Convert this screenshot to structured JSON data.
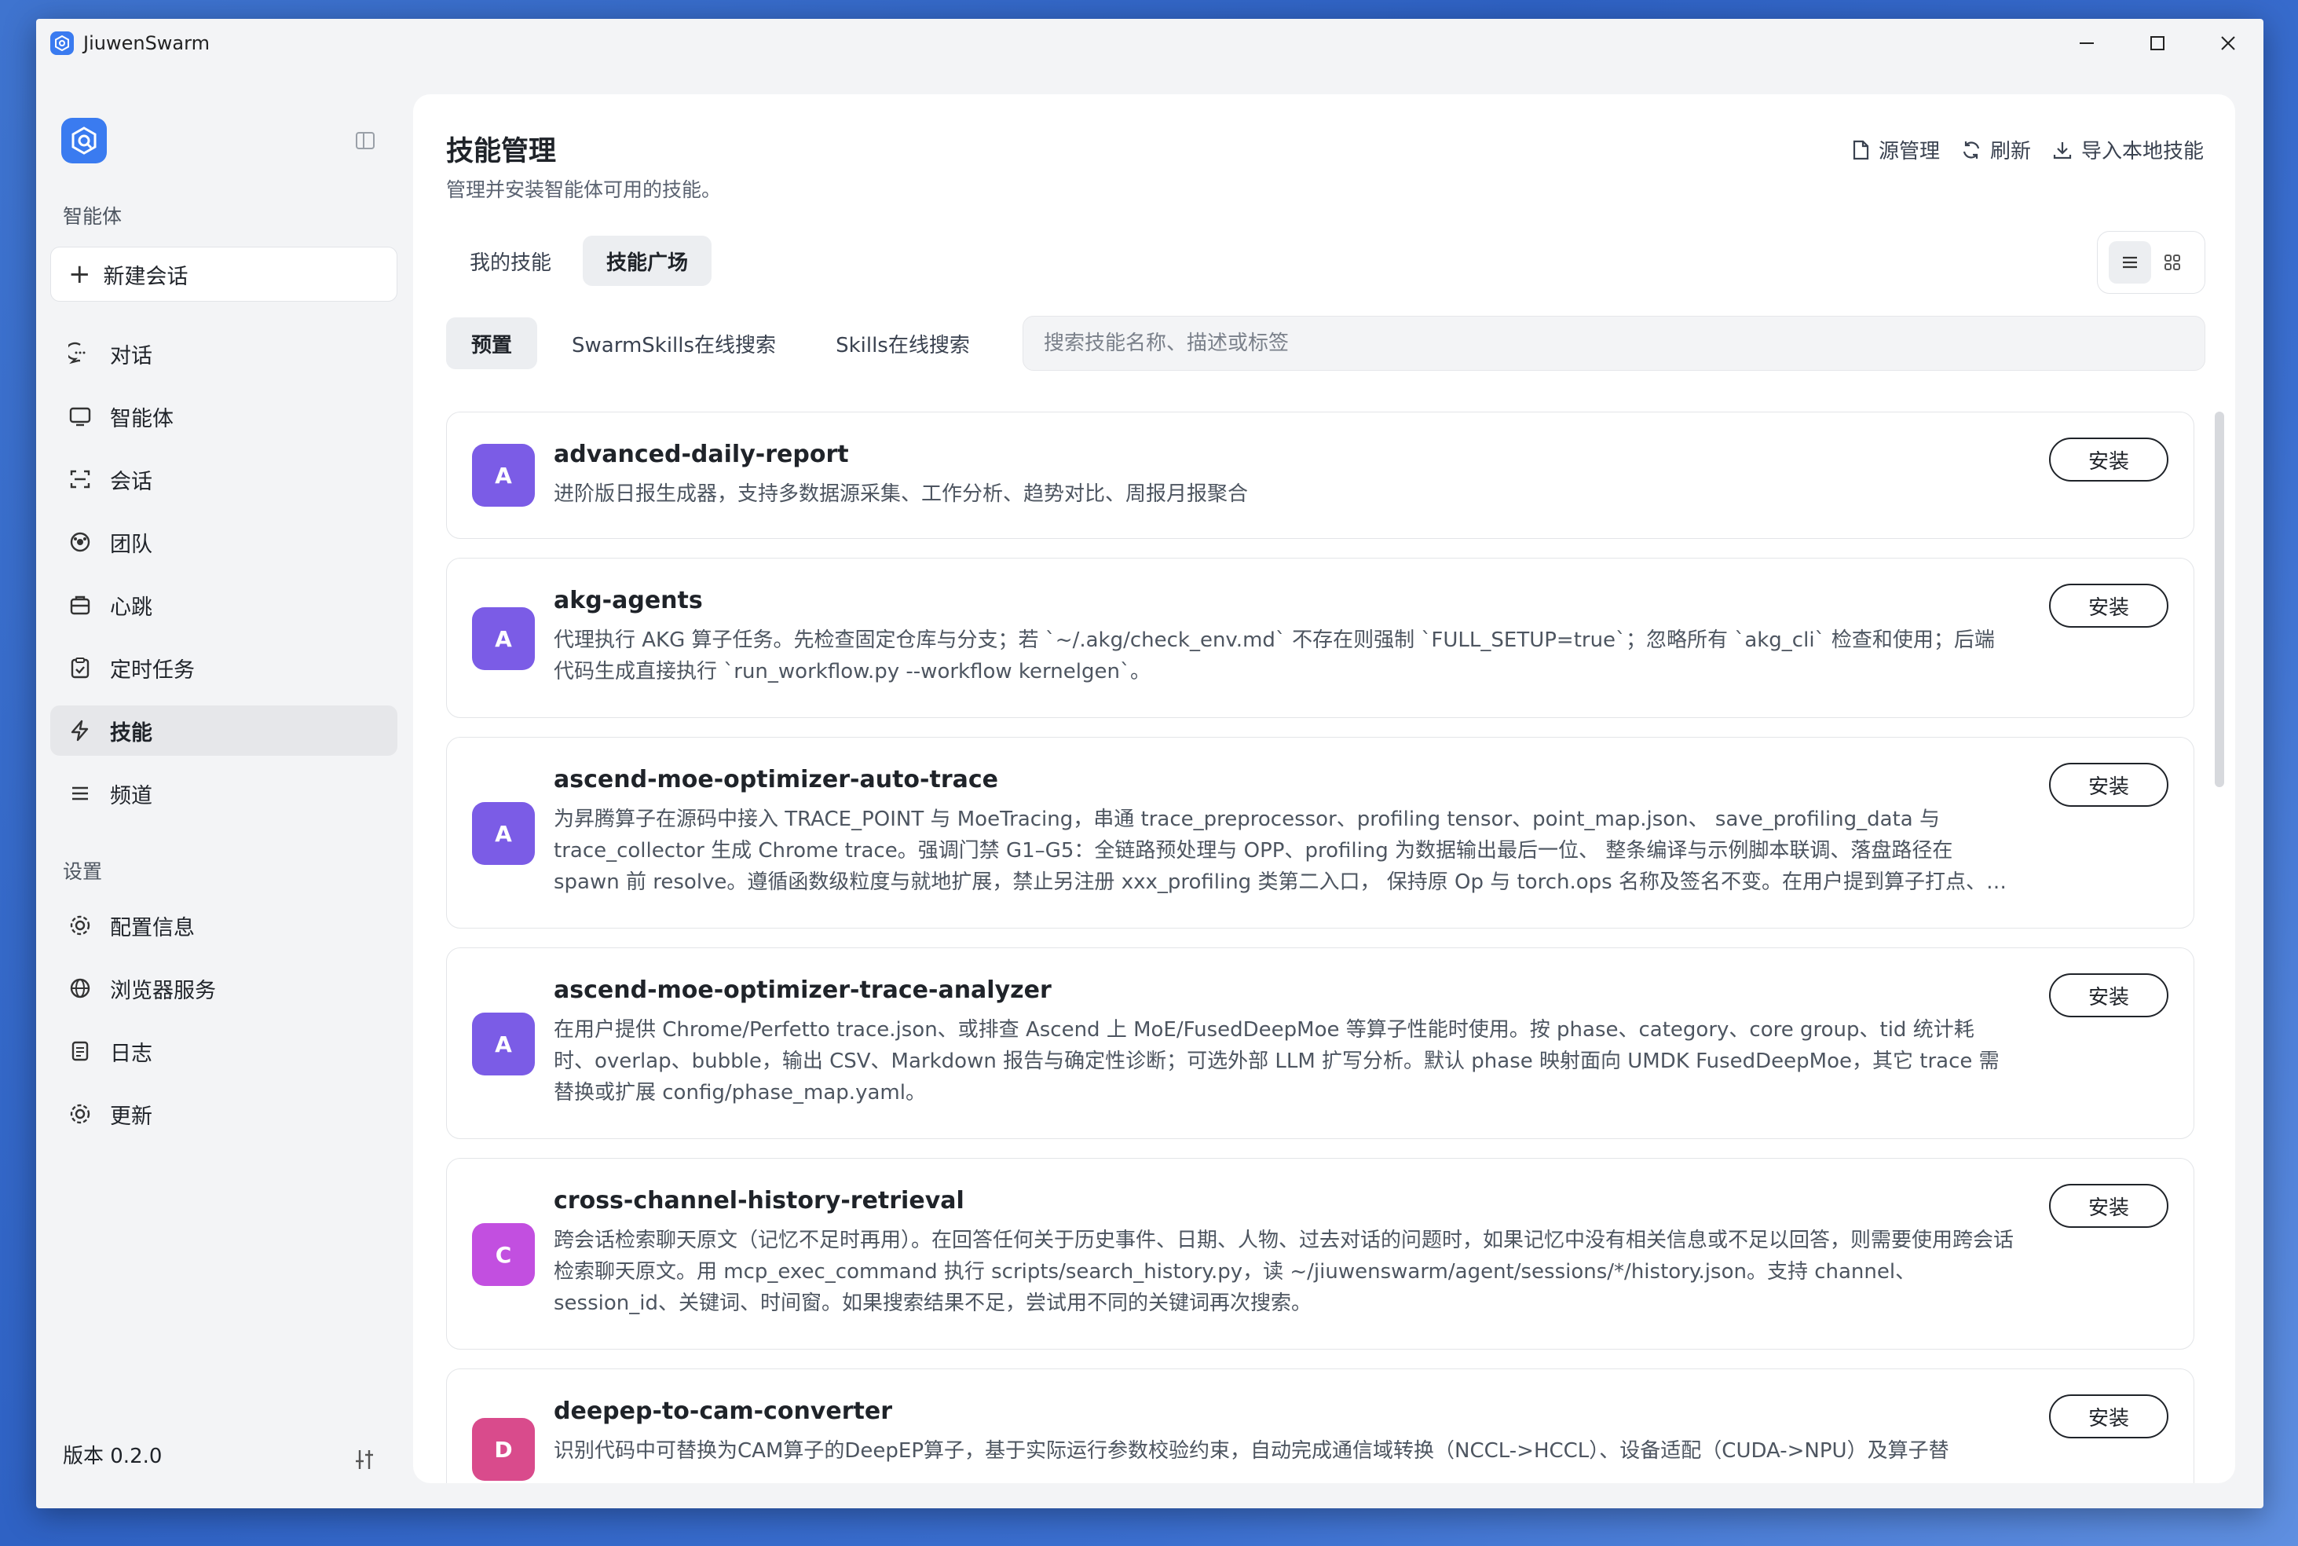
{
  "window": {
    "title": "JiuwenSwarm"
  },
  "sidebar": {
    "section_agents": "智能体",
    "new_chat": "新建会话",
    "items": [
      {
        "label": "对话",
        "icon": "chat-bubble-icon",
        "active": false
      },
      {
        "label": "智能体",
        "icon": "monitor-icon",
        "active": false
      },
      {
        "label": "会话",
        "icon": "session-scan-icon",
        "active": false
      },
      {
        "label": "团队",
        "icon": "team-globe-icon",
        "active": false
      },
      {
        "label": "心跳",
        "icon": "heartbeat-box-icon",
        "active": false
      },
      {
        "label": "定时任务",
        "icon": "clipboard-check-icon",
        "active": false
      },
      {
        "label": "技能",
        "icon": "lightning-icon",
        "active": true
      },
      {
        "label": "频道",
        "icon": "list-icon",
        "active": false
      }
    ],
    "section_settings": "设置",
    "settings_items": [
      {
        "label": "配置信息",
        "icon": "gear-icon"
      },
      {
        "label": "浏览器服务",
        "icon": "globe-icon"
      },
      {
        "label": "日志",
        "icon": "log-file-icon"
      },
      {
        "label": "更新",
        "icon": "update-gear-icon"
      }
    ],
    "version": "版本 0.2.0"
  },
  "main": {
    "title": "技能管理",
    "subtitle": "管理并安装智能体可用的技能。",
    "actions": [
      {
        "label": "源管理",
        "icon": "file-icon"
      },
      {
        "label": "刷新",
        "icon": "refresh-icon"
      },
      {
        "label": "导入本地技能",
        "icon": "download-icon"
      }
    ],
    "tabs": [
      {
        "label": "我的技能",
        "active": false
      },
      {
        "label": "技能广场",
        "active": true
      }
    ],
    "subtabs": [
      {
        "label": "预置",
        "active": true
      },
      {
        "label": "SwarmSkills在线搜索",
        "active": false
      },
      {
        "label": "Skills在线搜索",
        "active": false
      }
    ],
    "search_placeholder": "搜索技能名称、描述或标签",
    "install_label": "安装",
    "skills": [
      {
        "letter": "A",
        "color": "#7b5ce6",
        "name": "advanced-daily-report",
        "desc": "进阶版日报生成器，支持多数据源采集、工作分析、趋势对比、周报月报聚合"
      },
      {
        "letter": "A",
        "color": "#7b5ce6",
        "name": "akg-agents",
        "desc": "代理执行 AKG 算子任务。先检查固定仓库与分支；若 `~/.akg/check_env.md` 不存在则强制 `FULL_SETUP=true`；忽略所有 `akg_cli` 检查和使用；后端代码生成直接执行 `run_workflow.py --workflow kernelgen`。"
      },
      {
        "letter": "A",
        "color": "#7b5ce6",
        "name": "ascend-moe-optimizer-auto-trace",
        "desc": "为昇腾算子在源码中接入 TRACE_POINT 与 MoeTracing，串通 trace_preprocessor、profiling tensor、point_map.json、 save_profiling_data 与 trace_collector 生成 Chrome trace。强调门禁 G1–G5：全链路预处理与 OPP、profiling 为数据输出最后一位、 整条编译与示例脚本联调、落盘路径在 spawn 前 resolve。遵循函数级粒度与就地扩展，禁止另注册 xxx_profiling 类第二入口， 保持原 Op 与 torch.ops 名称及签名不变。在用户提到算子打点、…"
      },
      {
        "letter": "A",
        "color": "#7b5ce6",
        "name": "ascend-moe-optimizer-trace-analyzer",
        "desc": "在用户提供 Chrome/Perfetto trace.json、或排查 Ascend 上 MoE/FusedDeepMoe 等算子性能时使用。按 phase、category、core group、tid 统计耗时、overlap、bubble，输出 CSV、Markdown 报告与确定性诊断；可选外部 LLM 扩写分析。默认 phase 映射面向 UMDK FusedDeepMoe，其它 trace 需替换或扩展 config/phase_map.yaml。"
      },
      {
        "letter": "C",
        "color": "#c24fe0",
        "name": "cross-channel-history-retrieval",
        "desc": "跨会话检索聊天原文（记忆不足时再用）。在回答任何关于历史事件、日期、人物、过去对话的问题时，如果记忆中没有相关信息或不足以回答，则需要使用跨会话检索聊天原文。用 mcp_exec_command 执行 scripts/search_history.py，读 ~/jiuwenswarm/agent/sessions/*/history.json。支持 channel、session_id、关键词、时间窗。如果搜索结果不足，尝试用不同的关键词再次搜索。"
      },
      {
        "letter": "D",
        "color": "#d94b8c",
        "name": "deepep-to-cam-converter",
        "desc": "识别代码中可替换为CAM算子的DeepEP算子，基于实际运行参数校验约束，自动完成通信域转换（NCCL->HCCL）、设备适配（CUDA->NPU）及算子替"
      }
    ]
  }
}
